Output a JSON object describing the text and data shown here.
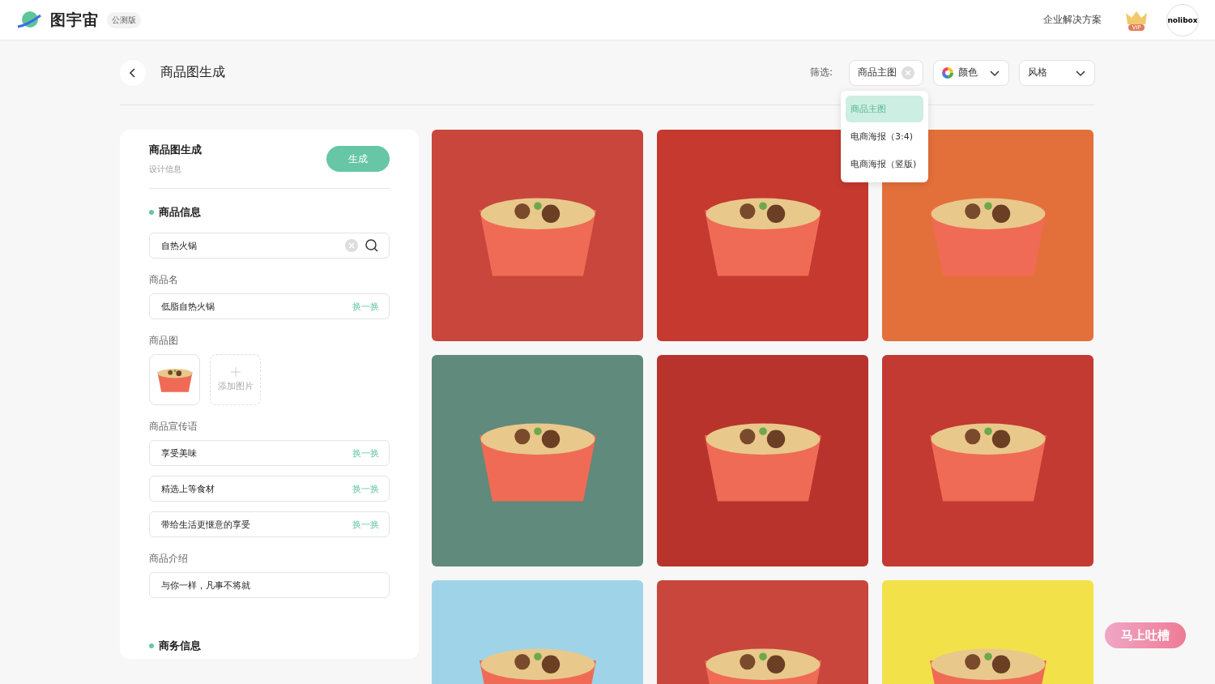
{
  "header": {
    "brand": "图宇宙",
    "badge": "公测版",
    "link": "企业解决方案",
    "vip": "VIP",
    "avatar": "nolibox"
  },
  "page": {
    "title": "商品图生成",
    "filter_label": "筛选:"
  },
  "filters": [
    {
      "kind": "clearable",
      "label": "商品主图"
    },
    {
      "kind": "color",
      "label": "颜色"
    },
    {
      "kind": "select",
      "label": "风格"
    }
  ],
  "dropdown": [
    {
      "label": "商品主图",
      "selected": true
    },
    {
      "label": "电商海报（3:4)",
      "selected": false
    },
    {
      "label": "电商海报（竖版)",
      "selected": false
    }
  ],
  "panel": {
    "title": "商品图生成",
    "subtitle": "设计信息",
    "generate": "生成",
    "section1": "商品信息",
    "search_value": "自热火锅",
    "name_label": "商品名",
    "name_value": "低脂自热火锅",
    "name_swap": "换一换",
    "image_label": "商品图",
    "add_image": "添加图片",
    "slogan_label": "商品宣传语",
    "slogans": [
      {
        "value": "享受美味",
        "swap": "换一换"
      },
      {
        "value": "精选上等食材",
        "swap": "换一换"
      },
      {
        "value": "带给生活更惬意的享受",
        "swap": "换一换"
      }
    ],
    "intro_label": "商品介绍",
    "intro_value": "与你一样，凡事不将就",
    "section2": "商务信息"
  },
  "posters": [
    {
      "color": "#c8463c"
    },
    {
      "color": "#c5392f"
    },
    {
      "color": "#e3703a"
    },
    {
      "color": "#5f8a7c"
    },
    {
      "color": "#b8332c"
    },
    {
      "color": "#c23a32"
    },
    {
      "color": "#9fd3e8"
    },
    {
      "color": "#c8463c"
    },
    {
      "color": "#f3e14a"
    }
  ],
  "feedback": "马上吐槽"
}
